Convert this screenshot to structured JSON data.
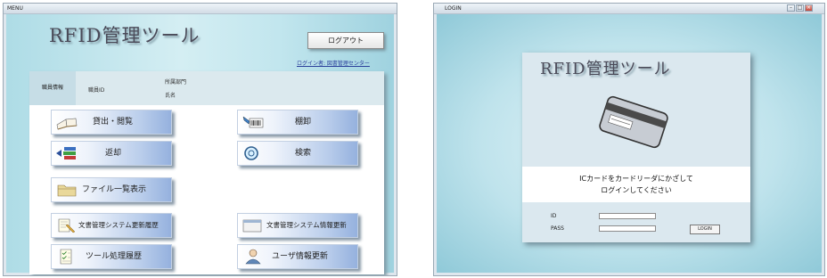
{
  "menu_window": {
    "title": "MENU",
    "app_title": "RFID管理ツール",
    "logout_label": "ログアウト",
    "login_user": "ログイン者: 図書管理センター",
    "info": {
      "section_label": "職員情報",
      "staff_id_label": "職員ID",
      "department_label": "所属部門",
      "name_label": "氏名"
    },
    "buttons": {
      "lend_browse": "貸出・閲覧",
      "inventory": "棚卸",
      "return": "返却",
      "search": "検索",
      "file_list": "ファイル一覧表示",
      "doc_update_history": "文書管理システム更新履歴",
      "doc_info_update": "文書管理システム情報更新",
      "tool_history": "ツール処理履歴",
      "user_info_update": "ユーザ情報更新"
    }
  },
  "login_window": {
    "title": "LOGIN",
    "app_title": "RFID管理ツール",
    "message_line1": "ICカードをカードリーダにかざして",
    "message_line2": "ログインしてください",
    "id_label": "ID",
    "pass_label": "PASS",
    "login_button": "LOGIN"
  },
  "colors": {
    "client_bg": "#c2e6ee",
    "button_gradient_end": "#95b1de",
    "link": "#2a3f9a"
  },
  "icons": [
    "book-icon",
    "barcode-icon",
    "books-icon",
    "search-icon",
    "folder-icon",
    "document-icon",
    "window-icon",
    "checklist-icon",
    "user-icon",
    "ic-card-icon"
  ]
}
